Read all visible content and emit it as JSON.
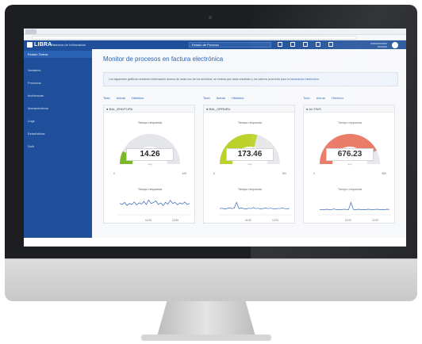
{
  "app": {
    "logo_text": "LIBRA",
    "app_name": "Sistemas de Información",
    "top_select": "Estado de Proceso",
    "user_line1": "xxxxxxxxxxxx",
    "user_line2": "xxxxxxx"
  },
  "sidebar": {
    "items": [
      {
        "label": "Estado Tareas"
      },
      {
        "label": "Variables"
      },
      {
        "label": "Procesos"
      },
      {
        "label": "Incidencias"
      },
      {
        "label": "Mantenimiento"
      },
      {
        "label": "Logs"
      },
      {
        "label": "Estadísticas"
      },
      {
        "label": "Salir"
      }
    ]
  },
  "page": {
    "title": "Monitor de procesos en factura electrónica",
    "info_text": "Los siguientes gráficos muestran información acerca de cada uno de los servicios, se estima que cada resultado y los valores promedio para la",
    "info_link": "facturación electrónica"
  },
  "cards": [
    {
      "tabs": [
        "Todo",
        "Actual",
        "Histórico"
      ],
      "title": "BAL_IENVTUPA",
      "gauge_title": "Tiempo respuesta",
      "value": "14.26",
      "unit": "seg",
      "min": "0",
      "max": "100",
      "fraction": 0.14,
      "color": "#7ab828",
      "spark_title": "Tiempo respuesta",
      "spark_points": [
        0.55,
        0.5,
        0.6,
        0.45,
        0.55,
        0.5,
        0.62,
        0.48,
        0.58,
        0.52,
        0.65,
        0.5,
        0.72,
        0.55,
        0.6,
        0.68,
        0.5,
        0.58,
        0.45,
        0.6,
        0.52,
        0.7,
        0.55,
        0.6,
        0.48,
        0.58,
        0.52,
        0.62,
        0.5,
        0.55
      ],
      "x_ticks": [
        "11:00",
        "12:00"
      ]
    },
    {
      "tabs": [
        "Todo",
        "Actual",
        "Histórico"
      ],
      "title": "BAL_OPRUEU",
      "gauge_title": "Tiempo respuesta",
      "value": "173.46",
      "unit": "seg",
      "min": "0",
      "max": "300",
      "fraction": 0.58,
      "color": "#bcd22a",
      "spark_title": "Tiempo respuesta",
      "spark_points": [
        0.3,
        0.32,
        0.28,
        0.3,
        0.34,
        0.3,
        0.32,
        0.6,
        0.3,
        0.33,
        0.3,
        0.28,
        0.32,
        0.3,
        0.35,
        0.3,
        0.32,
        0.28,
        0.3,
        0.33,
        0.3,
        0.32,
        0.3,
        0.28,
        0.31,
        0.3,
        0.33,
        0.3,
        0.29,
        0.31
      ],
      "x_ticks": [
        "11:00",
        "12:00"
      ]
    },
    {
      "tabs": [
        "Todo",
        "Actual",
        "Histórico"
      ],
      "title": "AU PAIS",
      "gauge_title": "Tiempo respuesta",
      "value": "676.23",
      "unit": "seg",
      "min": "0",
      "max": "800",
      "fraction": 0.85,
      "color": "#e8705a",
      "spark_title": "Tiempo respuesta",
      "spark_points": [
        0.25,
        0.26,
        0.25,
        0.27,
        0.25,
        0.26,
        0.28,
        0.25,
        0.26,
        0.25,
        0.27,
        0.26,
        0.25,
        0.6,
        0.26,
        0.25,
        0.27,
        0.25,
        0.26,
        0.25,
        0.27,
        0.26,
        0.25,
        0.26,
        0.27,
        0.25,
        0.26,
        0.25,
        0.27,
        0.26
      ],
      "x_ticks": [
        "11:00",
        "12:00"
      ]
    }
  ]
}
